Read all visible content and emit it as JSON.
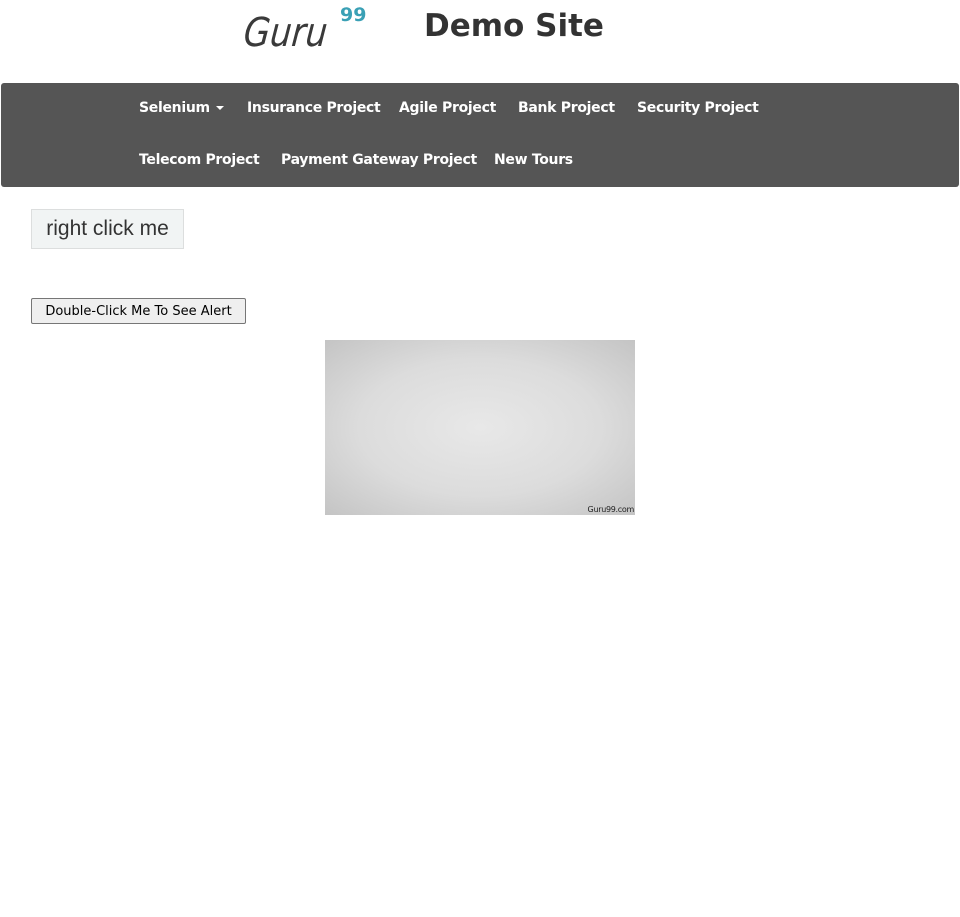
{
  "header": {
    "logo": {
      "word": "Guru",
      "superscript": "99",
      "superscript_color": "#3aa0b5"
    },
    "title": "Demo Site"
  },
  "navbar": {
    "background": "#555555",
    "items": [
      {
        "label": "Selenium",
        "has_dropdown": true
      },
      {
        "label": "Insurance Project"
      },
      {
        "label": "Agile Project"
      },
      {
        "label": "Bank Project"
      },
      {
        "label": "Security Project"
      },
      {
        "label": "Telecom Project"
      },
      {
        "label": "Payment Gateway Project"
      },
      {
        "label": "New Tours"
      }
    ]
  },
  "main": {
    "right_click_label": "right click me",
    "double_click_label": "Double-Click Me To See Alert",
    "image": {
      "watermark": "Guru99.com"
    }
  }
}
